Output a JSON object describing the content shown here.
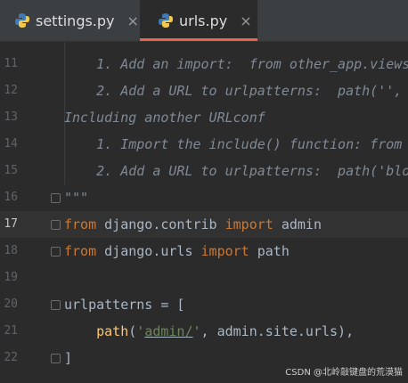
{
  "tabs": [
    {
      "label": "settings.py",
      "close": "×",
      "icon": "python-file-icon",
      "active": false
    },
    {
      "label": "urls.py",
      "close": "×",
      "icon": "python-file-icon",
      "active": true
    }
  ],
  "colors": {
    "background": "#2b2b2b",
    "keyword": "#cc7832",
    "string": "#6a8759",
    "function": "#ffc66d",
    "comment": "#7f8a96",
    "active_tab_accent": "#e7664d"
  },
  "lines": [
    {
      "n": "11",
      "comment": "    1. Add an import:  from other_app.views"
    },
    {
      "n": "12",
      "comment": "    2. Add a URL to urlpatterns:  path('',"
    },
    {
      "n": "13",
      "comment": "Including another URLconf"
    },
    {
      "n": "14",
      "comment": "    1. Import the include() function: from"
    },
    {
      "n": "15",
      "comment": "    2. Add a URL to urlpatterns:  path('blo"
    },
    {
      "n": "16",
      "comment": "\"\"\""
    },
    {
      "n": "17",
      "kw1": "from",
      "mod": " django.contrib ",
      "kw2": "import",
      "name": " admin"
    },
    {
      "n": "18",
      "kw1": "from",
      "mod": " django.urls ",
      "kw2": "import",
      "name": " path"
    },
    {
      "n": "19"
    },
    {
      "n": "20",
      "a": "urlpatterns ",
      "op": "=",
      "b": " ["
    },
    {
      "n": "21",
      "indent": "    ",
      "fn": "path",
      "p1": "(",
      "s1": "'",
      "s2": "admin/",
      "s3": "'",
      "rest": ", admin.site.urls),"
    },
    {
      "n": "22",
      "a": "]"
    }
  ],
  "watermark": "CSDN @北岭敲键盘的荒漠猫"
}
